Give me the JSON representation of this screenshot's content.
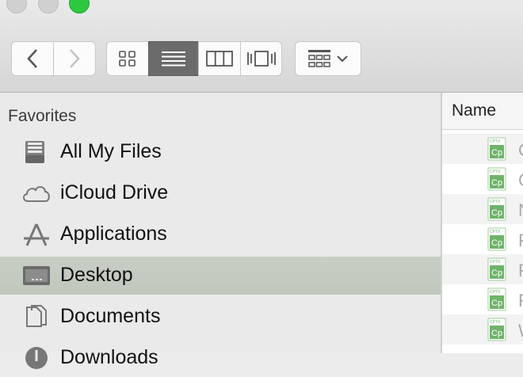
{
  "toolbar": {
    "traffic_lights": {
      "close_color": "#d0d0d0",
      "minimize_color": "#d0d0d0",
      "zoom_color": "#2dc840"
    },
    "nav_buttons": [
      "back",
      "forward"
    ],
    "view_modes": [
      "icon",
      "list",
      "columns",
      "cover-flow"
    ],
    "selected_view": "list",
    "arrange_icon": "arrange-grid-icon"
  },
  "sidebar": {
    "section_title": "Favorites",
    "items": [
      {
        "label": "All My Files",
        "icon": "all-files-icon",
        "selected": false
      },
      {
        "label": "iCloud Drive",
        "icon": "cloud-icon",
        "selected": false
      },
      {
        "label": "Applications",
        "icon": "applications-icon",
        "selected": false
      },
      {
        "label": "Desktop",
        "icon": "desktop-icon",
        "selected": true
      },
      {
        "label": "Documents",
        "icon": "documents-icon",
        "selected": false
      },
      {
        "label": "Downloads",
        "icon": "downloads-icon",
        "selected": false
      }
    ]
  },
  "filelist": {
    "column_header": "Name",
    "file_icon": "cptx-file-icon",
    "file_icon_text": {
      "top": "CPTX",
      "main": "Cp"
    },
    "rows": [
      {
        "name": "C"
      },
      {
        "name": "C"
      },
      {
        "name": "N"
      },
      {
        "name": "F"
      },
      {
        "name": "F"
      },
      {
        "name": "F"
      },
      {
        "name": "W"
      }
    ]
  },
  "colors": {
    "selection": "#c3c9bf",
    "cptx_green": "#6fb36a",
    "toolbar_selected": "#6b6b6b"
  }
}
